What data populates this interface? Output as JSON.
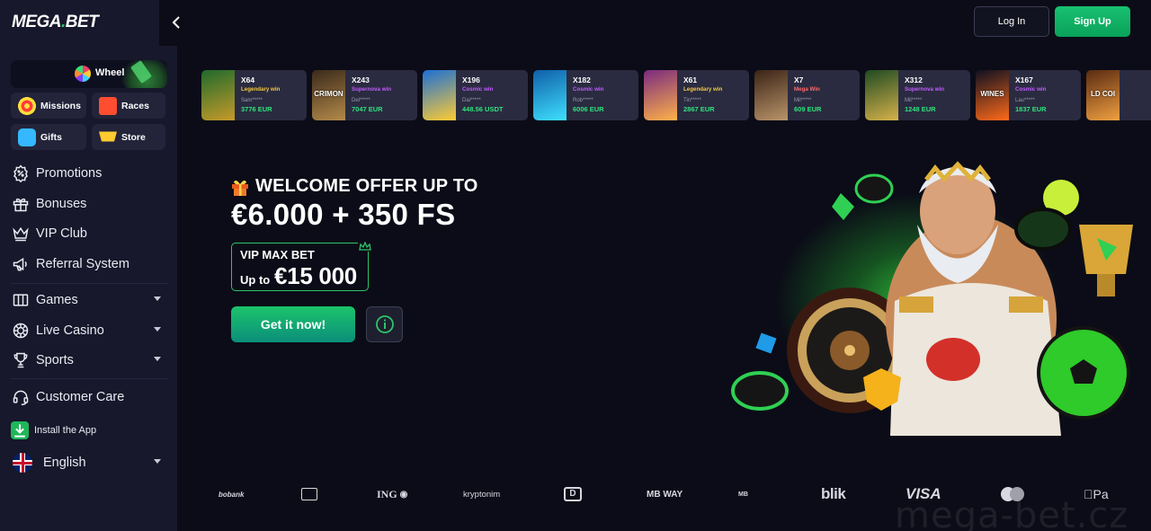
{
  "brand": {
    "logo_text": "MEGA",
    "logo_dot": ".",
    "logo_suffix": "BET"
  },
  "header": {
    "login_label": "Log In",
    "signup_label": "Sign Up"
  },
  "sidebar": {
    "wheel_label": "Wheel",
    "pills": [
      {
        "label": "Missions",
        "icon": "target-icon"
      },
      {
        "label": "Races",
        "icon": "flag-icon"
      },
      {
        "label": "Gifts",
        "icon": "gift-icon"
      },
      {
        "label": "Store",
        "icon": "cart-icon"
      }
    ],
    "nav": [
      {
        "label": "Promotions",
        "icon": "promotions-icon"
      },
      {
        "label": "Bonuses",
        "icon": "bonus-gift-icon"
      },
      {
        "label": "VIP Club",
        "icon": "crown-icon"
      },
      {
        "label": "Referral System",
        "icon": "megaphone-icon"
      },
      {
        "label": "Games",
        "icon": "games-icon",
        "expandable": true
      },
      {
        "label": "Live Casino",
        "icon": "chip-icon",
        "expandable": true
      },
      {
        "label": "Sports",
        "icon": "trophy-icon",
        "expandable": true
      },
      {
        "label": "Customer Care",
        "icon": "headset-icon"
      },
      {
        "label": "Install the App",
        "icon": "download-icon"
      },
      {
        "label": "English",
        "icon": "uk-flag-icon",
        "expandable": true
      }
    ]
  },
  "wins": [
    {
      "multiplier": "X64",
      "type": "Legendary win",
      "type_color": "#f5c842",
      "user": "Sam*****",
      "amount": "3776 EUR",
      "thumb": [
        "#1f6a2c",
        "#c79a2a"
      ]
    },
    {
      "multiplier": "X243",
      "type": "Supernova win",
      "type_color": "#c35cff",
      "user": "Del*****",
      "amount": "7047 EUR",
      "thumb": [
        "#3a2a1a",
        "#b48a4a"
      ]
    },
    {
      "multiplier": "X196",
      "type": "Cosmic win",
      "type_color": "#c35cff",
      "user": "Dai*****",
      "amount": "448.56 USDT",
      "thumb": [
        "#1b6fd6",
        "#ffcc33"
      ]
    },
    {
      "multiplier": "X182",
      "type": "Cosmic win",
      "type_color": "#c35cff",
      "user": "Rob*****",
      "amount": "6006 EUR",
      "thumb": [
        "#0f5fa8",
        "#3fe0ff"
      ]
    },
    {
      "multiplier": "X61",
      "type": "Legendary win",
      "type_color": "#f5c842",
      "user": "Tin*****",
      "amount": "2867 EUR",
      "thumb": [
        "#7a2a7e",
        "#ffb24a"
      ]
    },
    {
      "multiplier": "X7",
      "type": "Mega Win",
      "type_color": "#ff6a6a",
      "user": "Mil*****",
      "amount": "609 EUR",
      "thumb": [
        "#3b2416",
        "#b9946a"
      ]
    },
    {
      "multiplier": "X312",
      "type": "Supernova win",
      "type_color": "#c35cff",
      "user": "Mil*****",
      "amount": "1248 EUR",
      "thumb": [
        "#1f4a22",
        "#d6b24a"
      ]
    },
    {
      "multiplier": "X167",
      "type": "Cosmic win",
      "type_color": "#c35cff",
      "user": "Lau*****",
      "amount": "1837 EUR",
      "thumb": [
        "#0e1020",
        "#ff6a1a"
      ]
    },
    {
      "multiplier": "",
      "type": "",
      "type_color": "#c35cff",
      "user": "",
      "amount": "",
      "thumb": [
        "#5a2a12",
        "#f0a040"
      ]
    }
  ],
  "thumb_texts": [
    "",
    "CRIMON",
    "",
    "",
    "",
    "",
    "",
    "WINES",
    "LD COI"
  ],
  "hero": {
    "line1": "WELCOME OFFER UP TO",
    "line2": "€6.000 + 350 FS",
    "vip_title": "VIP MAX BET",
    "vip_upto": "Up to",
    "vip_amount": "€15 000",
    "cta_label": "Get it now!"
  },
  "payments": [
    "bobank",
    "",
    "ING",
    "kryptonim",
    "",
    "MB WAY",
    "MB",
    "blik",
    "VISA",
    "",
    "Pa"
  ],
  "watermark": "mega-bet.cz",
  "colors": {
    "accent": "#1ec66b",
    "sidebar_bg": "#17182b",
    "page_bg": "#0b0c17",
    "card_bg": "#2a2b40",
    "amount": "#2ee37c"
  }
}
